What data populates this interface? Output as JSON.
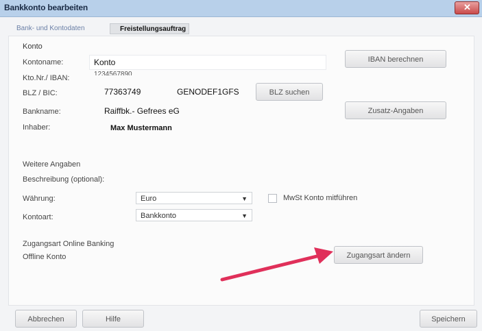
{
  "title": "Bankkonto bearbeiten",
  "tabs": [
    "Bank- und Kontodaten",
    "Freistellungsauftrag"
  ],
  "section_konto": "Konto",
  "fields": {
    "kontoname": {
      "label": "Kontoname:",
      "value": "Konto"
    },
    "ktonr": {
      "label": "Kto.Nr./ IBAN:",
      "value": "1234567890"
    },
    "blz": {
      "label": "BLZ / BIC:",
      "value": "77363749",
      "bic": "GENODEF1GFS"
    },
    "bankname": {
      "label": "Bankname:",
      "value": "Raiffbk.- Gefrees eG"
    },
    "inhaber": {
      "label": "Inhaber:",
      "value": "Max Mustermann"
    }
  },
  "buttons": {
    "iban": "IBAN berechnen",
    "blz_suchen": "BLZ suchen",
    "zusatz": "Zusatz-Angaben",
    "zugangsart_aendern": "Zugangsart ändern",
    "abbrechen": "Abbrechen",
    "hilfe": "Hilfe",
    "speichern": "Speichern"
  },
  "weitere": {
    "heading": "Weitere Angaben",
    "beschreibung_label": "Beschreibung (optional):",
    "waehrung_label": "Währung:",
    "waehrung_value": "Euro",
    "mwst_label": "MwSt Konto mitführen",
    "kontoart_label": "Kontoart:",
    "kontoart_value": "Bankkonto"
  },
  "zugang": {
    "heading": "Zugangsart Online Banking",
    "value": "Offline Konto"
  },
  "colors": {
    "arrow": "#e0305a",
    "titlebar": "#b8d0ea"
  }
}
